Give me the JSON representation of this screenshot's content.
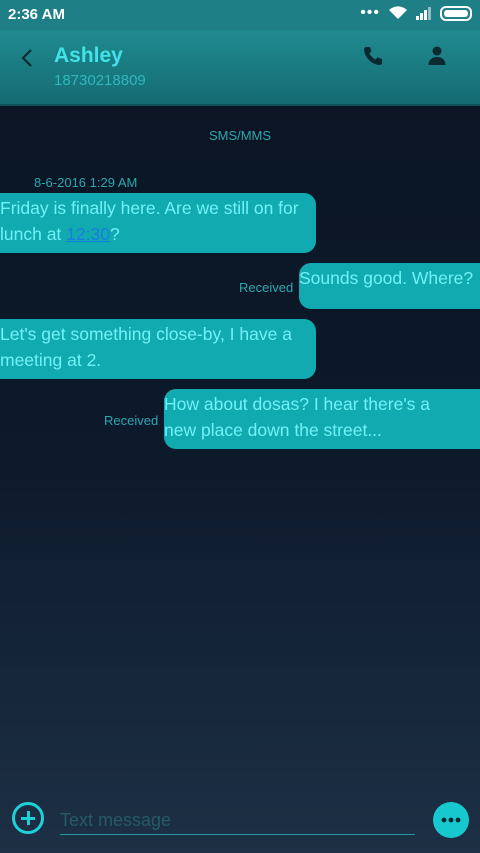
{
  "status_bar": {
    "time": "2:36 AM",
    "dots": "•••"
  },
  "header": {
    "contact_name": "Ashley",
    "contact_number": "18730218809"
  },
  "conversation": {
    "channel_label": "SMS/MMS",
    "timestamp": "8-6-2016 1:29 AM",
    "messages": [
      {
        "direction": "outgoing",
        "line1": "Friday is finally here. Are we still on for",
        "line2_prefix": "lunch at ",
        "line2_link": "12:30",
        "line2_suffix": "?"
      },
      {
        "direction": "incoming",
        "text": "Sounds good. Where?",
        "status": "Received"
      },
      {
        "direction": "outgoing",
        "line1": "Let's get something close-by, I have a",
        "line2": "meeting at 2."
      },
      {
        "direction": "incoming",
        "line1": "How about dosas? I hear there's a",
        "line2": "new place down the street...",
        "status": "Received"
      }
    ]
  },
  "composer": {
    "placeholder": "Text message"
  },
  "colors": {
    "accent": "#1fd0d7",
    "bubble": "#12aab1",
    "header": "#1f8b91",
    "link": "#1a7de0"
  }
}
